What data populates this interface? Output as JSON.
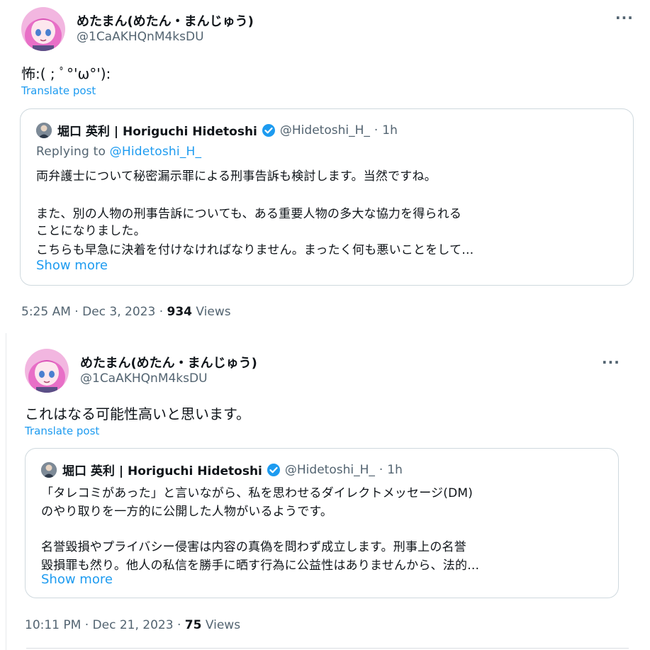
{
  "posts": [
    {
      "author": {
        "name": "めたまん(めたん・まんじゅう)",
        "handle": "@1CaAKHQnM4ksDU"
      },
      "text": "怖:( ; ﾟ°'ω°'):",
      "translate_label": "Translate post",
      "quote": {
        "author_name": "堀口 英利 | Horiguchi Hidetoshi",
        "author_handle": "@Hidetoshi_H_",
        "separator": "·",
        "time": "1h",
        "replying_prefix": "Replying to ",
        "replying_handle": "@Hidetoshi_H_",
        "lines": [
          "両弁護士について秘密漏示罪による刑事告訴も検討します。当然ですね。",
          "",
          "また、別の人物の刑事告訴についても、ある重要人物の多大な協力を得られる",
          "ことになりました。",
          "こちらも早急に決着を付けなければなりません。まったく何も悪いことをして…"
        ],
        "show_more": "Show more"
      },
      "meta": {
        "time": "5:25 AM",
        "sep": " · ",
        "date": "Dec 3, 2023",
        "views_count": "934",
        "views_label": " Views"
      }
    },
    {
      "author": {
        "name": "めたまん(めたん・まんじゅう)",
        "handle": "@1CaAKHQnM4ksDU"
      },
      "text": "これはなる可能性高いと思います。",
      "translate_label": "Translate post",
      "quote": {
        "author_name": "堀口 英利 | Horiguchi Hidetoshi",
        "author_handle": "@Hidetoshi_H_",
        "separator": "·",
        "time": "1h",
        "lines": [
          "「タレコミがあった」と言いながら、私を思わせるダイレクトメッセージ(DM)",
          "のやり取りを一方的に公開した人物がいるようです。",
          "",
          "名誉毀損やプライバシー侵害は内容の真偽を問わず成立します。刑事上の名誉",
          "毀損罪も然り。他人の私信を勝手に晒す行為に公益性はありませんから、法的…"
        ],
        "show_more": "Show more"
      },
      "meta": {
        "time": "10:11 PM",
        "sep": " · ",
        "date": "Dec 21, 2023",
        "views_count": "75",
        "views_label": " Views"
      }
    }
  ],
  "icons": {
    "more": "more-horizontal-icon",
    "verified": "verified-badge-icon",
    "avatar": "anime-avatar-icon"
  },
  "colors": {
    "link": "#1d9bf0",
    "verified": "#1d9bf0",
    "secondary_text": "#536471",
    "primary_text": "#0f1419",
    "border": "#cfd9de"
  }
}
